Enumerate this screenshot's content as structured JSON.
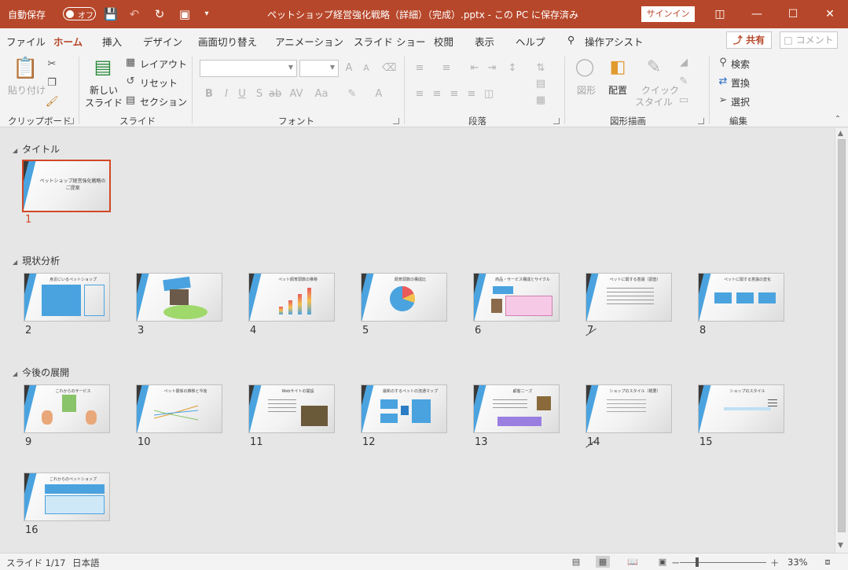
{
  "titlebar": {
    "autosave_label": "自動保存",
    "autosave_state": "オフ",
    "document_title": "ペットショップ経営強化戦略（詳細）（完成）.pptx - この PC に保存済み",
    "signin_label": "サインイン",
    "accent_color": "#b7472a"
  },
  "tabs": [
    "ファイル",
    "ホーム",
    "挿入",
    "デザイン",
    "画面切り替え",
    "アニメーション",
    "スライド ショー",
    "校閲",
    "表示",
    "ヘルプ",
    "操作アシスト"
  ],
  "active_tab": "ホーム",
  "share_label": "共有",
  "comment_label": "コメント",
  "ribbon": {
    "clipboard": {
      "label": "クリップボード",
      "paste": "貼り付け"
    },
    "slides": {
      "label": "スライド",
      "new_slide": "新しい",
      "new_slide2": "スライド",
      "layout": "レイアウト",
      "reset": "リセット",
      "section": "セクション"
    },
    "font": {
      "label": "フォント"
    },
    "paragraph": {
      "label": "段落"
    },
    "drawing": {
      "label": "図形描画",
      "shapes": "図形",
      "arrange": "配置",
      "quick_styles": "クイック",
      "quick_styles2": "スタイル"
    },
    "editing": {
      "label": "編集",
      "find": "検索",
      "replace": "置換",
      "select": "選択"
    }
  },
  "sections": [
    {
      "title": "タイトル"
    },
    {
      "title": "現状分析"
    },
    {
      "title": "今後の展開"
    }
  ],
  "slides": [
    {
      "num": "1",
      "title": "ペットショップ経営強化戦略のご提案"
    },
    {
      "num": "2",
      "title": "身近にいるペットショップ"
    },
    {
      "num": "3",
      "title": ""
    },
    {
      "num": "4",
      "title": "ペット飼育頭数の推移"
    },
    {
      "num": "5",
      "title": "飼育頭数の構成比"
    },
    {
      "num": "6",
      "title": "商品・サービス構成とサイクル"
    },
    {
      "num": "7",
      "title": "ペットに関する意識（調査）"
    },
    {
      "num": "8",
      "title": "ペットに関する意識の変化"
    },
    {
      "num": "9",
      "title": "これからのサービス"
    },
    {
      "num": "10",
      "title": "ペット関係の推移と今後"
    },
    {
      "num": "11",
      "title": "Webサイトの開設"
    },
    {
      "num": "12",
      "title": "最新のするペットの流通マップ"
    },
    {
      "num": "13",
      "title": "顧客ニーズ"
    },
    {
      "num": "14",
      "title": "ショップのスタイル（概要）"
    },
    {
      "num": "15",
      "title": "ショップのスタイル"
    },
    {
      "num": "16",
      "title": "これからのペットショップ"
    }
  ],
  "status": {
    "slide_pos": "スライド 1/17",
    "language": "日本語",
    "zoom": "33%",
    "zoom_minus": "－",
    "zoom_plus": "＋"
  }
}
